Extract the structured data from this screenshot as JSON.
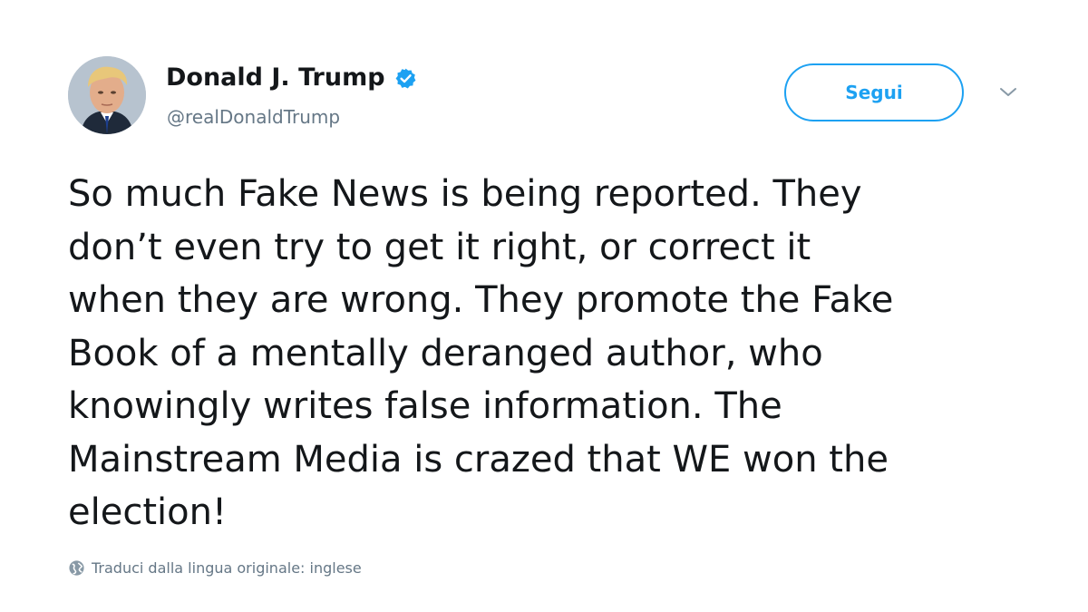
{
  "user": {
    "display_name": "Donald J. Trump",
    "handle": "@realDonaldTrump",
    "verified": true
  },
  "actions": {
    "follow_label": "Segui"
  },
  "tweet": {
    "lines": [
      "So much Fake News is being reported. They",
      "don’t even try to get it right, or correct it",
      "when they are wrong. They promote the Fake",
      "Book of a mentally deranged author, who",
      "knowingly writes false information. The",
      "Mainstream Media is crazed that WE won the",
      "election!"
    ]
  },
  "translate": {
    "label": "Traduci dalla lingua originale: inglese"
  },
  "colors": {
    "accent": "#1da1f2",
    "text": "#14171a",
    "secondary": "#657786"
  },
  "icons": {
    "verified": "verified-badge-icon",
    "caret": "chevron-down-icon",
    "globe": "globe-icon"
  }
}
